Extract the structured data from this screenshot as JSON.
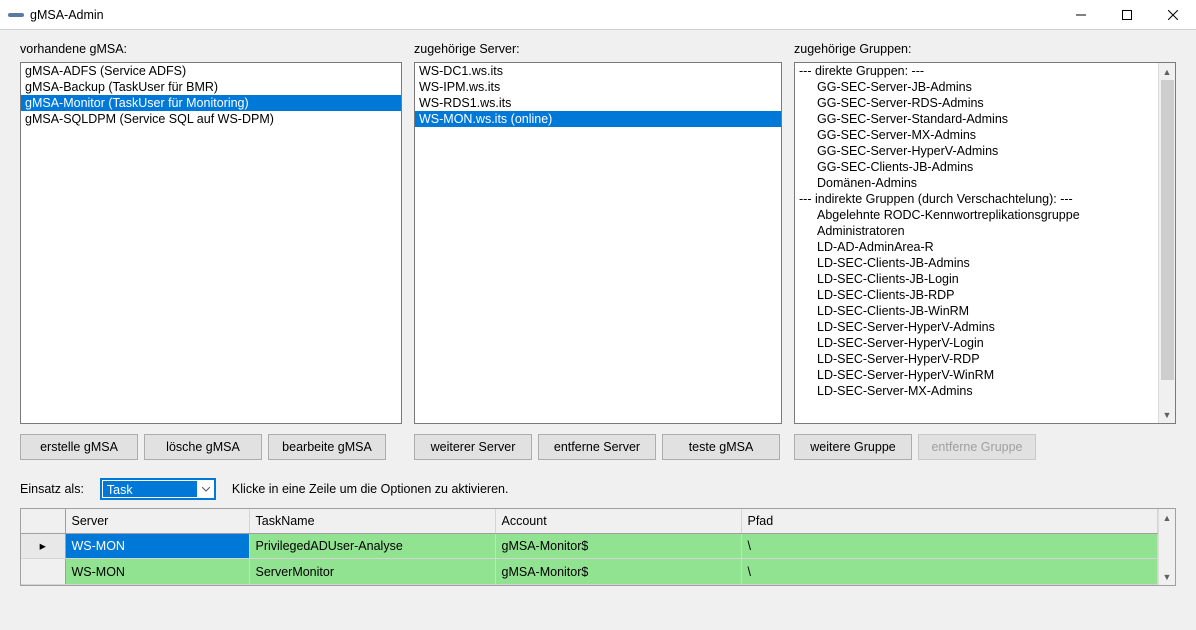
{
  "window": {
    "title": "gMSA-Admin"
  },
  "labels": {
    "gmsa_list": "vorhandene gMSA:",
    "server_list": "zugehörige Server:",
    "group_list": "zugehörige Gruppen:",
    "einsatz_als": "Einsatz als:",
    "hint": "Klicke in eine Zeile um die Optionen zu aktivieren."
  },
  "gmsa_items": [
    {
      "text": "gMSA-ADFS (Service ADFS)",
      "selected": false
    },
    {
      "text": "gMSA-Backup (TaskUser für BMR)",
      "selected": false
    },
    {
      "text": "gMSA-Monitor (TaskUser für Monitoring)",
      "selected": true
    },
    {
      "text": "gMSA-SQLDPM (Service SQL auf WS-DPM)",
      "selected": false
    }
  ],
  "server_items": [
    {
      "text": "WS-DC1.ws.its",
      "selected": false
    },
    {
      "text": "WS-IPM.ws.its",
      "selected": false
    },
    {
      "text": "WS-RDS1.ws.its",
      "selected": false
    },
    {
      "text": "WS-MON.ws.its (online)",
      "selected": true
    }
  ],
  "group_items": [
    {
      "text": "--- direkte Gruppen: ---",
      "indent": false
    },
    {
      "text": "GG-SEC-Server-JB-Admins",
      "indent": true
    },
    {
      "text": "GG-SEC-Server-RDS-Admins",
      "indent": true
    },
    {
      "text": "GG-SEC-Server-Standard-Admins",
      "indent": true
    },
    {
      "text": "GG-SEC-Server-MX-Admins",
      "indent": true
    },
    {
      "text": "GG-SEC-Server-HyperV-Admins",
      "indent": true
    },
    {
      "text": "GG-SEC-Clients-JB-Admins",
      "indent": true
    },
    {
      "text": "Domänen-Admins",
      "indent": true
    },
    {
      "text": "",
      "indent": false
    },
    {
      "text": "--- indirekte Gruppen (durch Verschachtelung): ---",
      "indent": false
    },
    {
      "text": "Abgelehnte RODC-Kennwortreplikationsgruppe",
      "indent": true
    },
    {
      "text": "Administratoren",
      "indent": true
    },
    {
      "text": "LD-AD-AdminArea-R",
      "indent": true
    },
    {
      "text": "LD-SEC-Clients-JB-Admins",
      "indent": true
    },
    {
      "text": "LD-SEC-Clients-JB-Login",
      "indent": true
    },
    {
      "text": "LD-SEC-Clients-JB-RDP",
      "indent": true
    },
    {
      "text": "LD-SEC-Clients-JB-WinRM",
      "indent": true
    },
    {
      "text": "LD-SEC-Server-HyperV-Admins",
      "indent": true
    },
    {
      "text": "LD-SEC-Server-HyperV-Login",
      "indent": true
    },
    {
      "text": "LD-SEC-Server-HyperV-RDP",
      "indent": true
    },
    {
      "text": "LD-SEC-Server-HyperV-WinRM",
      "indent": true
    },
    {
      "text": "LD-SEC-Server-MX-Admins",
      "indent": true
    }
  ],
  "buttons": {
    "erstelle_gmsa": "erstelle gMSA",
    "loesche_gmsa": "lösche gMSA",
    "bearbeite_gmsa": "bearbeite gMSA",
    "weiterer_server": "weiterer Server",
    "entferne_server": "entferne Server",
    "teste_gmsa": "teste gMSA",
    "weitere_gruppe": "weitere Gruppe",
    "entferne_gruppe": "entferne Gruppe"
  },
  "combo": {
    "value": "Task"
  },
  "grid": {
    "headers": {
      "server": "Server",
      "taskname": "TaskName",
      "account": "Account",
      "pfad": "Pfad"
    },
    "rows": [
      {
        "selected": true,
        "server": "WS-MON",
        "taskname": "PrivilegedADUser-Analyse",
        "account": "gMSA-Monitor$",
        "pfad": "\\"
      },
      {
        "selected": false,
        "server": "WS-MON",
        "taskname": "ServerMonitor",
        "account": "gMSA-Monitor$",
        "pfad": "\\"
      }
    ]
  }
}
